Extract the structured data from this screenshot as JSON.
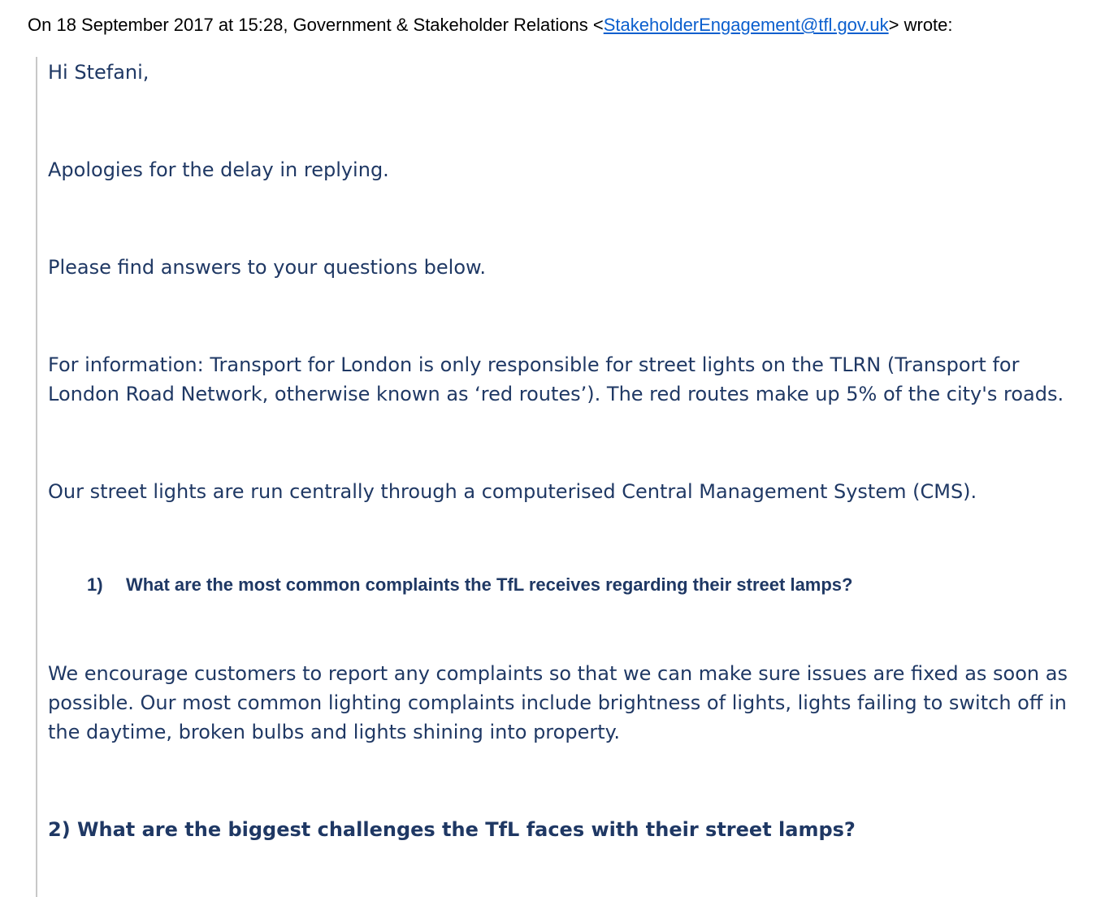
{
  "header": {
    "prefix": "On 18 September 2017 at 15:28, Government & Stakeholder Relations <",
    "email": "StakeholderEngagement@tfl.gov.uk",
    "suffix": "> wrote:"
  },
  "message": {
    "greeting": "Hi Stefani,",
    "apology": "Apologies for the delay in replying.",
    "intro": "Please find answers to your questions below.",
    "info": "For information: Transport for London is only responsible for street lights on the TLRN (Transport for London Road Network, otherwise known as ‘red routes’). The red routes make up 5% of the city's roads.",
    "cms": "Our street lights are run centrally through a computerised Central Management System (CMS).",
    "question1": {
      "number": "1)",
      "text": "What are the most common complaints the TfL receives regarding their street lamps?"
    },
    "answer1": "We encourage customers to report any complaints so that we can make sure issues are fixed as soon as possible. Our most common lighting complaints include brightness of lights, lights failing to switch off in the daytime, broken bulbs and lights shining into property.",
    "question2": "2) What are the biggest challenges the TfL faces with their street lamps?"
  },
  "colors": {
    "body_text": "#1f3864",
    "link": "#0b5fce",
    "quote_bar": "#c8c8c8"
  }
}
